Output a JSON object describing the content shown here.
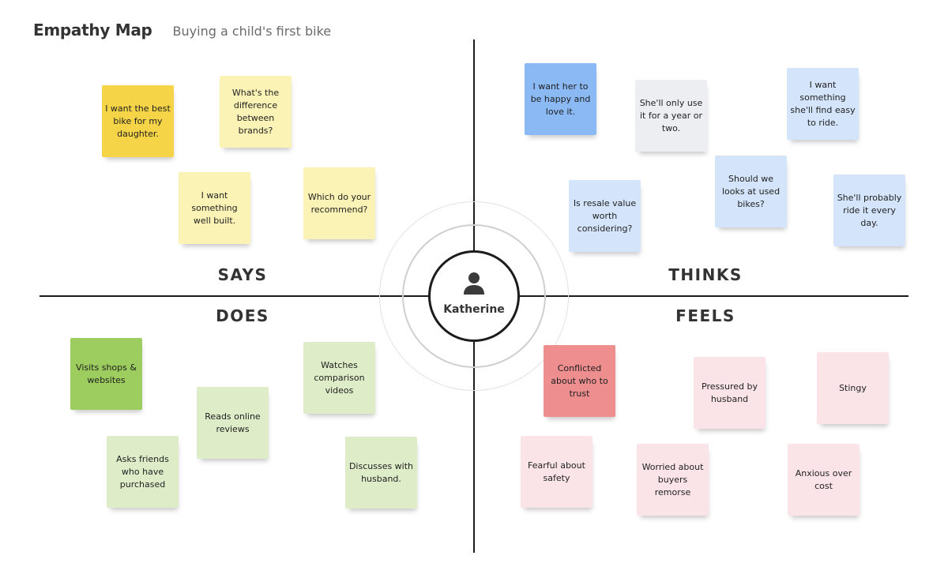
{
  "header": {
    "title": "Empathy Map",
    "subtitle": "Buying a child's first bike"
  },
  "center": {
    "icon": "person-icon",
    "name": "Katherine"
  },
  "quadrants": {
    "says": {
      "label": "SAYS",
      "notes": [
        {
          "text": "I want the best bike for my daughter.",
          "color": "#f5d547"
        },
        {
          "text": "What's  the difference between brands?",
          "color": "#fbf3b6"
        },
        {
          "text": "I want something well built.",
          "color": "#fbf3b6"
        },
        {
          "text": "Which do your recommend?",
          "color": "#fbf3b6"
        }
      ]
    },
    "thinks": {
      "label": "THINKS",
      "notes": [
        {
          "text": "I want her to be happy and love it.",
          "color": "#8ab9f4"
        },
        {
          "text": "She'll only use it for a year or two.",
          "color": "#eceef2"
        },
        {
          "text": "I want something she'll find easy to ride.",
          "color": "#d4e5fb"
        },
        {
          "text": "Should we looks at used bikes?",
          "color": "#d4e5fb"
        },
        {
          "text": "Is resale value worth considering?",
          "color": "#d4e5fb"
        },
        {
          "text": "She'll probably ride it every day.",
          "color": "#d4e5fb"
        }
      ]
    },
    "does": {
      "label": "DOES",
      "notes": [
        {
          "text": "Visits shops & websites",
          "color": "#9ccd5e"
        },
        {
          "text": "Watches comparison videos",
          "color": "#deecc8"
        },
        {
          "text": "Reads online reviews",
          "color": "#deecc8"
        },
        {
          "text": "Asks friends who have purchased",
          "color": "#deecc8"
        },
        {
          "text": "Discusses with husband.",
          "color": "#deecc8"
        }
      ]
    },
    "feels": {
      "label": "FEELS",
      "notes": [
        {
          "text": "Conflicted about who to trust",
          "color": "#ee8e8e"
        },
        {
          "text": "Pressured by husband",
          "color": "#fae4e8"
        },
        {
          "text": "Stingy",
          "color": "#fae4e8"
        },
        {
          "text": "Fearful about safety",
          "color": "#fae4e8"
        },
        {
          "text": "Worried about buyers remorse",
          "color": "#fae4e8"
        },
        {
          "text": "Anxious over cost",
          "color": "#fae4e8"
        }
      ]
    }
  }
}
